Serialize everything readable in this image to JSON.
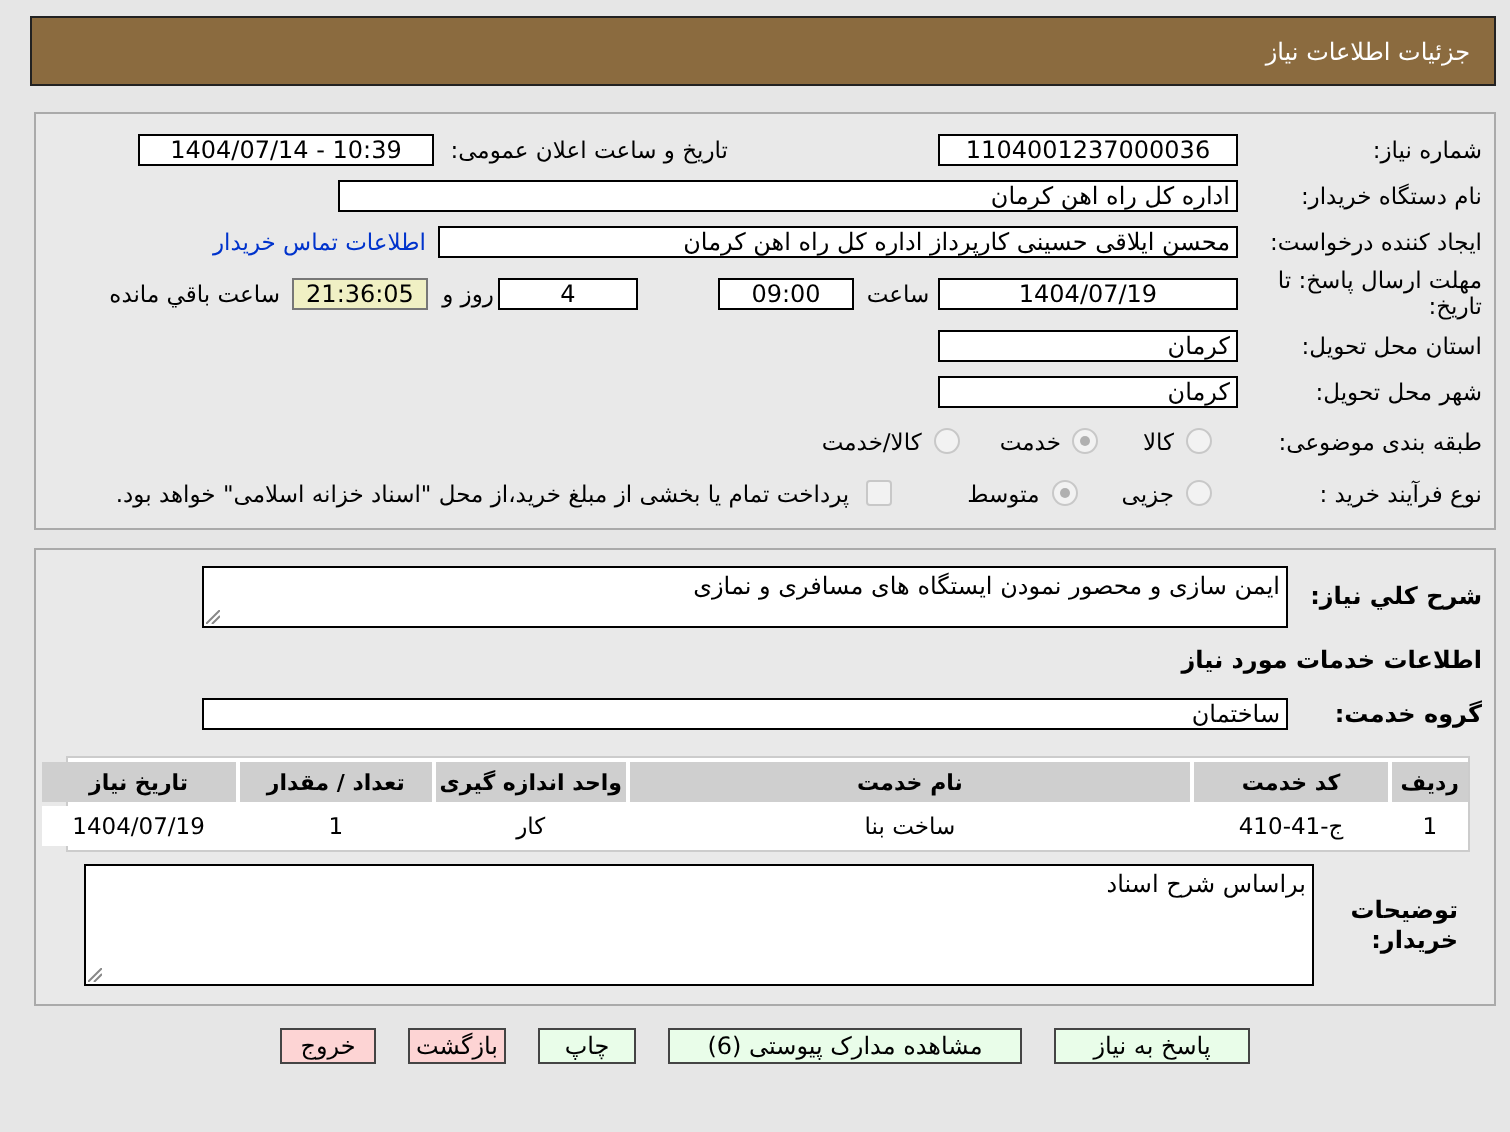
{
  "header": {
    "title": "جزئیات اطلاعات نیاز"
  },
  "details": {
    "need_number": {
      "label": "شماره نیاز:",
      "value": "1104001237000036"
    },
    "announce": {
      "label": "تاریخ و ساعت اعلان عمومی:",
      "value": "1404/07/14 - 10:39"
    },
    "buyer_org": {
      "label": "نام دستگاه خریدار:",
      "value": "اداره کل راه اهن کرمان"
    },
    "requester": {
      "label": "ایجاد کننده درخواست:",
      "value": "محسن ایلاقی حسینی کارپرداز اداره کل راه اهن کرمان",
      "link": "اطلاعات تماس خریدار"
    },
    "deadline": {
      "label": "مهلت ارسال پاسخ: تا تاریخ:",
      "date": "1404/07/19",
      "time_label": "ساعت",
      "time": "09:00",
      "days": "4",
      "days_label": "روز و",
      "remaining": "21:36:05",
      "remaining_label": "ساعت باقي مانده"
    },
    "province": {
      "label": "استان محل تحویل:",
      "value": "کرمان"
    },
    "city": {
      "label": "شهر محل تحویل:",
      "value": "کرمان"
    },
    "category": {
      "label": "طبقه بندی موضوعی:",
      "options": [
        {
          "label": "کالا",
          "selected": false
        },
        {
          "label": "خدمت",
          "selected": true
        },
        {
          "label": "کالا/خدمت",
          "selected": false
        }
      ]
    },
    "purchase_type": {
      "label": "نوع فرآیند خرید :",
      "options": [
        {
          "label": "جزیی",
          "selected": false
        },
        {
          "label": "متوسط",
          "selected": true
        }
      ],
      "payment": {
        "checked": false,
        "label": "پرداخت تمام یا بخشی از مبلغ خرید،از محل \"اسناد خزانه اسلامی\" خواهد بود."
      }
    }
  },
  "description": {
    "label": "شرح کلي نیاز:",
    "value": "ایمن سازی و محصور نمودن ایستگاه های مسافری و نمازی"
  },
  "services_title": "اطلاعات خدمات مورد نیاز",
  "service_group": {
    "label": "گروه خدمت:",
    "value": "ساختمان"
  },
  "table": {
    "columns": [
      "ردیف",
      "کد خدمت",
      "نام خدمت",
      "واحد اندازه گیری",
      "تعداد / مقدار",
      "تاریخ نیاز"
    ],
    "rows": [
      [
        "1",
        "ج-41-410",
        "ساخت بنا",
        "کار",
        "1",
        "1404/07/19"
      ]
    ]
  },
  "buyer_notes": {
    "label": "توضیحات خریدار:",
    "value": "براساس شرح اسناد"
  },
  "buttons": [
    {
      "label": "پاسخ به نیاز",
      "kind": "action"
    },
    {
      "label": "مشاهده مدارک پیوستی (6)",
      "kind": "action"
    },
    {
      "label": "چاپ",
      "kind": "action"
    },
    {
      "label": "بازگشت",
      "kind": "exit"
    },
    {
      "label": "خروج",
      "kind": "exit"
    }
  ]
}
